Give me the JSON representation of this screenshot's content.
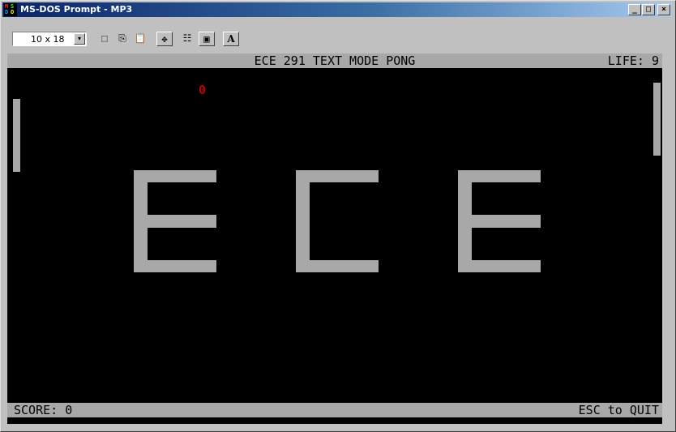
{
  "window": {
    "title": "MS-DOS Prompt - MP3",
    "icon": "ms-dos-icon",
    "icon_letters": [
      "M",
      "S",
      "D",
      "O"
    ],
    "controls": {
      "minimize": "_",
      "maximize": "□",
      "close": "×"
    }
  },
  "toolbar": {
    "font_size": "10 x 18",
    "dropdown_arrow": "▾",
    "buttons": [
      {
        "name": "mark-icon",
        "glyph": "⬚"
      },
      {
        "name": "copy-icon",
        "glyph": "⎘"
      },
      {
        "name": "paste-icon",
        "glyph": "📋"
      },
      {
        "name": "fullscreen-icon",
        "glyph": "✥"
      },
      {
        "name": "properties-icon",
        "glyph": "☷"
      },
      {
        "name": "background-icon",
        "glyph": "▣"
      },
      {
        "name": "font-icon",
        "glyph": "A"
      }
    ]
  },
  "game": {
    "title": "ECE 291 TEXT MODE PONG",
    "life_text": "LIFE: 9",
    "score_text": "SCORE: 0",
    "quit_text": "ESC to QUIT",
    "ball_char": "0",
    "banner_letters": [
      "E",
      "C",
      "E"
    ],
    "colors": {
      "background": "#000000",
      "status_bar": "#a8a8a8",
      "paddle": "#a8a8a8",
      "ball": "#c00000",
      "banner": "#a8a8a8"
    }
  }
}
